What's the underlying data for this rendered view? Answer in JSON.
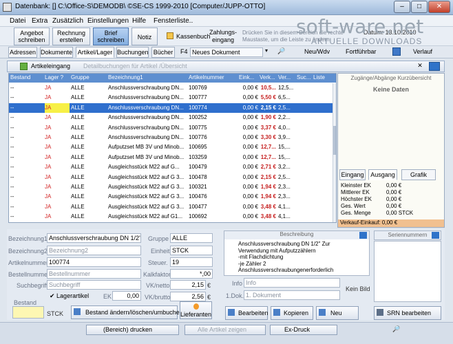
{
  "title": "Datenbank: [] C:\\Office-S\\DEMODB\\ ©SE-CS 1999-2010 [Computer/JUPP-OTTO]",
  "window_controls": {
    "min": "–",
    "max": "□",
    "close": "✕"
  },
  "menu": [
    "Datei",
    "Extra",
    "Zusätzlich",
    "Einstellungen",
    "Hilfe",
    "Fensterliste.."
  ],
  "toolbar": {
    "angebot": [
      "Angebot",
      "schreiben"
    ],
    "rechnung": [
      "Rechnung",
      "erstellen"
    ],
    "brief": [
      "Brief",
      "schreiben"
    ],
    "notiz": "Notiz",
    "kassenbuch": "Kassenbuch",
    "zahlungseingang": [
      "Zahlungs-",
      "eingang"
    ],
    "hint": "Drücken Sie in diesem Bereich die rechte Maustaste, um die Leiste zu ändern.",
    "datum": "Datum: 13.10.2010"
  },
  "watermark": {
    "main": "soft-ware.net",
    "sub": "AKTUELLE DOWNLOADS"
  },
  "tabs": [
    "Adressen",
    "Dokumente",
    "Artikel/Lager",
    "Buchungen",
    "Bücher"
  ],
  "toolbar2": {
    "f4": "F4",
    "neues_dokument": "Neues Dokument",
    "neu_wdv": "Neu/Wdv",
    "fortfuehrbar": "Fortführbar",
    "verlauf": "Verlauf"
  },
  "row3": {
    "artikeleingang": "Artikeleingang",
    "detail": "Detailbuchungen für Artikel /Übersicht"
  },
  "table": {
    "columns": [
      "Bestand",
      "Lager ?",
      "Gruppe",
      "Bezeichnung1",
      "Artikelnummer",
      "Eink...",
      "Verk...",
      "Ver...",
      "Suc...",
      "Liste"
    ],
    "rows": [
      [
        "--",
        "JA",
        "ALLE",
        "Anschlussverschraubung DN...",
        "100769",
        "0,00 €",
        "10,5...",
        "12,5..."
      ],
      [
        "--",
        "JA",
        "ALLE",
        "Anschlussverschraubung DN...",
        "100777",
        "0,00 €",
        "5,50 €",
        "6,5..."
      ],
      [
        "--",
        "JA",
        "ALLE",
        "Anschlussverschraubung DN...",
        "100774",
        "0,00 €",
        "2,15 €",
        "2,5..."
      ],
      [
        "--",
        "JA",
        "ALLE",
        "Anschlussverschraubung DN...",
        "100252",
        "0,00 €",
        "1,90 €",
        "2,2..."
      ],
      [
        "--",
        "JA",
        "ALLE",
        "Anschlussverschraubung DN...",
        "100775",
        "0,00 €",
        "3,37 €",
        "4,0..."
      ],
      [
        "--",
        "JA",
        "ALLE",
        "Anschlussverschraubung DN...",
        "100776",
        "0,00 €",
        "3,30 €",
        "3,9..."
      ],
      [
        "--",
        "JA",
        "ALLE",
        "Aufputzset MB 3V und Minob...",
        "100695",
        "0,00 €",
        "12,7...",
        "15,..."
      ],
      [
        "--",
        "JA",
        "ALLE",
        "Aufputzset MB 3V und Minob...",
        "103259",
        "0,00 €",
        "12,7...",
        "15,..."
      ],
      [
        "--",
        "JA",
        "ALLE",
        "Ausgleichsstück M22 auf G...",
        "100479",
        "0,00 €",
        "2,71 €",
        "3,2..."
      ],
      [
        "--",
        "JA",
        "ALLE",
        "Ausgleichsstück M22 auf G 3...",
        "100478",
        "0,00 €",
        "2,15 €",
        "2,5..."
      ],
      [
        "--",
        "JA",
        "ALLE",
        "Ausgleichsstück M22 auf G 3...",
        "100321",
        "0,00 €",
        "1,94 €",
        "2,3..."
      ],
      [
        "--",
        "JA",
        "ALLE",
        "Ausgleichsstück M22 auf G 3...",
        "100476",
        "0,00 €",
        "1,94 €",
        "2,3..."
      ],
      [
        "--",
        "JA",
        "ALLE",
        "Ausgleichsstück M22 auf G 3...",
        "100477",
        "0,00 €",
        "3,48 €",
        "4,1..."
      ],
      [
        "--",
        "JA",
        "ALLE",
        "Ausgleichsstück M22 auf G1...",
        "100692",
        "0,00 €",
        "3,48 €",
        "4,1..."
      ]
    ],
    "selected_index": 2
  },
  "rightpanel": {
    "title": "Zugänge/Abgänge Kurzübersicht",
    "empty": "Keine Daten",
    "tabs": [
      "Eingang",
      "Ausgang",
      "Grafik"
    ],
    "stats": [
      [
        "Kleinster EK",
        "0,00 €"
      ],
      [
        "Mittlerer EK",
        "0,00 €"
      ],
      [
        "Höchster EK",
        "0,00 €"
      ],
      [
        "Ges. Wert",
        "0,00 €"
      ],
      [
        "Ges. Menge",
        "0,00 STCK"
      ]
    ],
    "footer": "Verkauf-Einkauf: 0,00 €"
  },
  "form": {
    "bezeichnung1": {
      "label": "Bezeichnung1",
      "value": "Anschlussverschraubung DN 1/2\" ve"
    },
    "bezeichnung2": {
      "label": "Bezeichnung2",
      "placeholder": "Bezeichnung2"
    },
    "artikelnummer": {
      "label": "Artikelnummer",
      "value": "100774"
    },
    "bestellnummer": {
      "label": "Bestellnummer",
      "placeholder": "Bestellnummer"
    },
    "suchbegriff": {
      "label": "Suchbegriff",
      "placeholder": "Suchbegriff"
    },
    "lagerartikel": "Lagerartikel",
    "ek": {
      "label": "EK",
      "value": "0,00"
    },
    "bestand": "Bestand",
    "stck": "STCK",
    "gruppe": {
      "label": "Gruppe",
      "value": "ALLE"
    },
    "einheit": {
      "label": "Einheit",
      "value": "STCK"
    },
    "steuer": {
      "label": "Steuer.",
      "value": "19"
    },
    "kalkfaktor": {
      "label": "Kalkfaktor",
      "value": "*,00"
    },
    "vknetto": {
      "label": "VK/netto",
      "value": "2,15",
      "cur": "€"
    },
    "vkbrutto": {
      "label": "VK/brutto",
      "value": "2,56",
      "cur": "€"
    },
    "beschreibung": {
      "title": "Beschreibung",
      "text": [
        "Anschlussverschraubung DN 1/2\" Zur",
        "Verwendung mit Aufputzzählern",
        "-mit Flachdichtung",
        "-je Zähler 2",
        "Anschlussverschraubungenerforderlich"
      ]
    },
    "seriennummern": "Seriennummern",
    "info": {
      "label": "Info",
      "placeholder": "Info"
    },
    "dok": {
      "label": "1.Dok.",
      "placeholder": "1. Dokument"
    },
    "keinbild": "Kein Bild"
  },
  "buttons": {
    "bestand_aendern": "Bestand ändern/löschen/umbuchen",
    "lieferanten": "Lieferanten",
    "bearbeiten": "Bearbeiten",
    "kopieren": "Kopieren",
    "neu": "Neu",
    "srn": "SRN bearbeiten"
  },
  "status": {
    "drucken": "(Bereich) drucken",
    "alle_artikel": "Alle Artikel zeigen",
    "exdruck": "Ex-Druck"
  }
}
